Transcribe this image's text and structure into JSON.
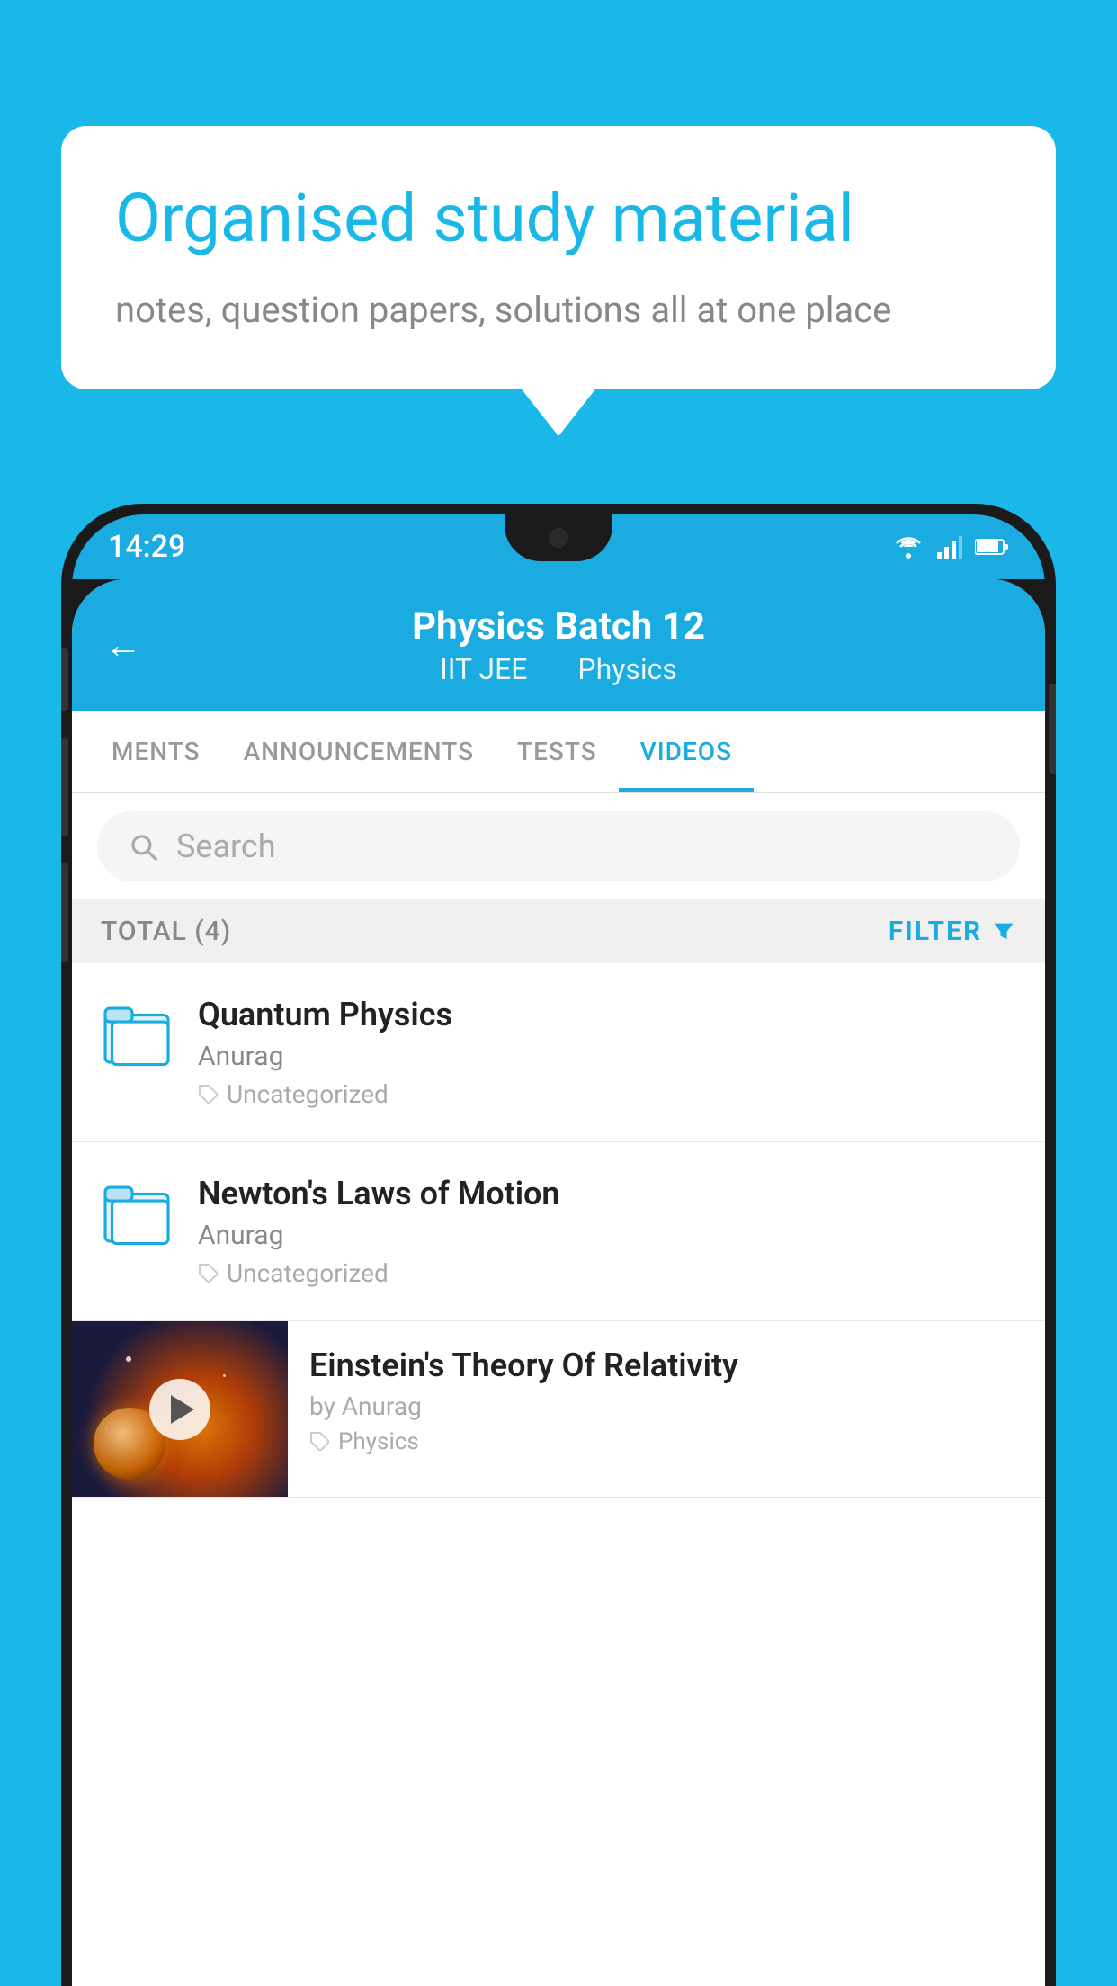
{
  "background_color": "#1ab8e8",
  "bubble": {
    "title": "Organised study material",
    "subtitle": "notes, question papers, solutions all at one place"
  },
  "status_bar": {
    "time": "14:29",
    "icons": [
      "wifi",
      "signal",
      "battery"
    ]
  },
  "header": {
    "back_label": "←",
    "title": "Physics Batch 12",
    "subtitle_part1": "IIT JEE",
    "subtitle_part2": "Physics"
  },
  "tabs": [
    {
      "label": "MENTS",
      "active": false
    },
    {
      "label": "ANNOUNCEMENTS",
      "active": false
    },
    {
      "label": "TESTS",
      "active": false
    },
    {
      "label": "VIDEOS",
      "active": true
    }
  ],
  "search": {
    "placeholder": "Search"
  },
  "filter_bar": {
    "total_label": "TOTAL (4)",
    "filter_label": "FILTER"
  },
  "videos": [
    {
      "title": "Quantum Physics",
      "author": "Anurag",
      "tag": "Uncategorized",
      "has_thumbnail": false
    },
    {
      "title": "Newton's Laws of Motion",
      "author": "Anurag",
      "tag": "Uncategorized",
      "has_thumbnail": false
    },
    {
      "title": "Einstein's Theory Of Relativity",
      "author": "by Anurag",
      "tag": "Physics",
      "has_thumbnail": true
    }
  ]
}
